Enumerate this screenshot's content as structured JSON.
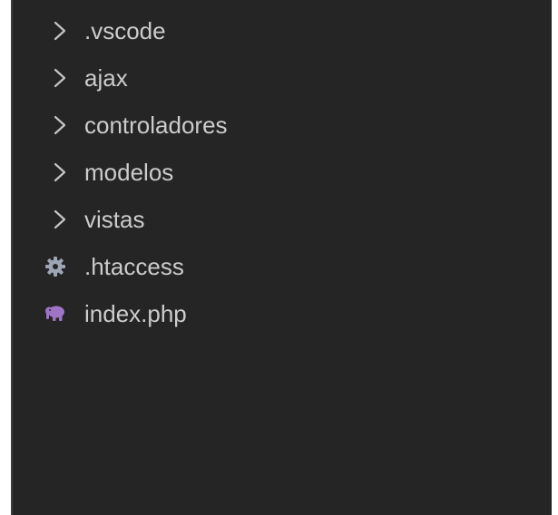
{
  "explorer": {
    "items": [
      {
        "type": "folder",
        "label": ".vscode",
        "icon": "chevron-right-icon"
      },
      {
        "type": "folder",
        "label": "ajax",
        "icon": "chevron-right-icon"
      },
      {
        "type": "folder",
        "label": "controladores",
        "icon": "chevron-right-icon"
      },
      {
        "type": "folder",
        "label": "modelos",
        "icon": "chevron-right-icon"
      },
      {
        "type": "folder",
        "label": "vistas",
        "icon": "chevron-right-icon"
      },
      {
        "type": "file",
        "label": ".htaccess",
        "icon": "gear-icon",
        "icon_color": "#9da5b4"
      },
      {
        "type": "file",
        "label": "index.php",
        "icon": "elephant-icon",
        "icon_color": "#a074c4"
      }
    ],
    "colors": {
      "background": "#252526",
      "text": "#cccccc",
      "chevron": "#c5c5c5"
    }
  }
}
